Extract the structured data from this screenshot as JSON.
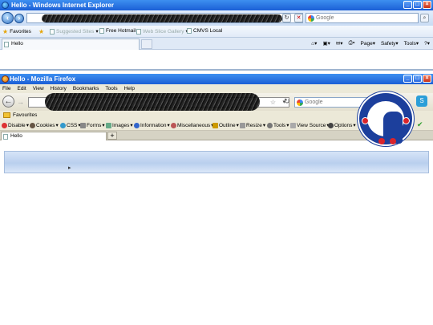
{
  "ie": {
    "title": "Hello - Windows Internet Explorer",
    "search_placeholder": "Google",
    "favorites_label": "Favorites",
    "fav_items": [
      "Suggested Sites",
      "Free Hotmail",
      "Web Slice Gallery",
      "CMVS Local"
    ],
    "tab_title": "Hello",
    "commands": [
      "Page",
      "Safety",
      "Tools"
    ]
  },
  "ff": {
    "title": "Hello - Mozilla Firefox",
    "menu": [
      "File",
      "Edit",
      "View",
      "History",
      "Bookmarks",
      "Tools",
      "Help"
    ],
    "search_placeholder": "Google",
    "bookmarks_label": "Favourites",
    "devtools": [
      "Disable",
      "Cookies",
      "CSS",
      "Forms",
      "Images",
      "Information",
      "Miscellaneous",
      "Outline",
      "Resize",
      "Tools",
      "View Source",
      "Options"
    ],
    "tab_title": "Hello",
    "new_tab": "+"
  },
  "colors": {
    "title_bar": "#1b5fd6",
    "banner": "#b9cfee",
    "crest_blue": "#1c3f9c",
    "crest_red": "#d9242b"
  }
}
